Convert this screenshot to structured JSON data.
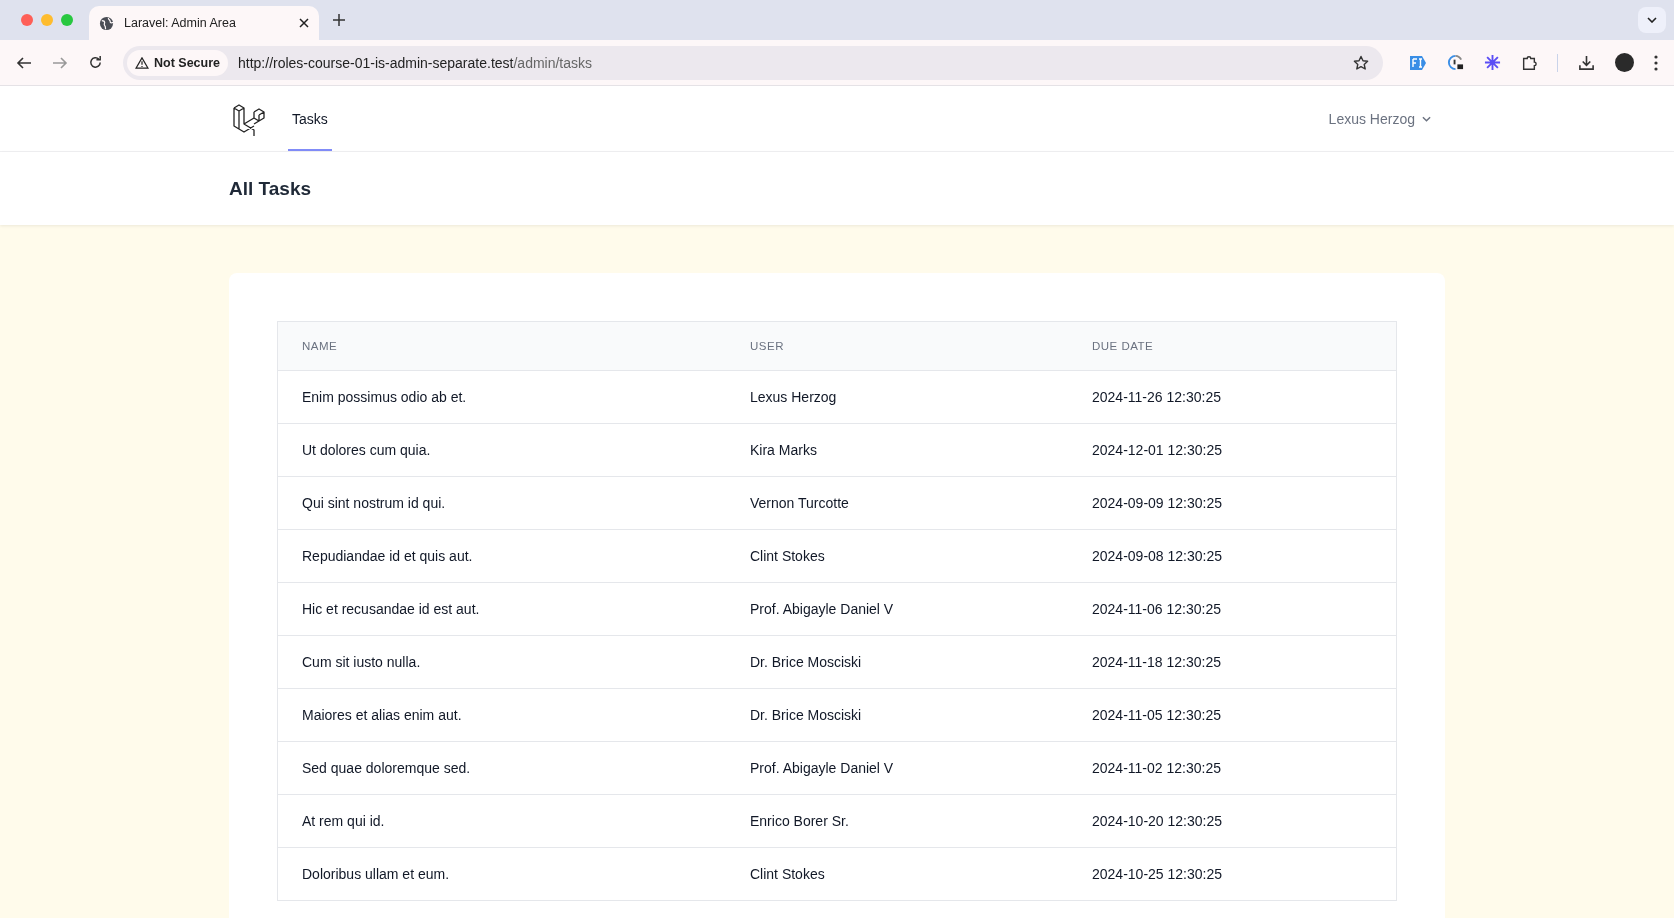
{
  "browser": {
    "tab": {
      "title": "Laravel: Admin Area"
    },
    "security_chip": "Not Secure",
    "url_host": "http://roles-course-01-is-admin-separate.test",
    "url_path": "/admin/tasks"
  },
  "nav": {
    "items": [
      {
        "label": "Tasks",
        "selected": true
      }
    ],
    "user": "Lexus Herzog"
  },
  "header": {
    "title": "All Tasks"
  },
  "table": {
    "columns": [
      "NAME",
      "USER",
      "DUE DATE"
    ],
    "rows": [
      [
        "Enim possimus odio ab et.",
        "Lexus Herzog",
        "2024-11-26 12:30:25"
      ],
      [
        "Ut dolores cum quia.",
        "Kira Marks",
        "2024-12-01 12:30:25"
      ],
      [
        "Qui sint nostrum id qui.",
        "Vernon Turcotte",
        "2024-09-09 12:30:25"
      ],
      [
        "Repudiandae id et quis aut.",
        "Clint Stokes",
        "2024-09-08 12:30:25"
      ],
      [
        "Hic et recusandae id est aut.",
        "Prof. Abigayle Daniel V",
        "2024-11-06 12:30:25"
      ],
      [
        "Cum sit iusto nulla.",
        "Dr. Brice Mosciski",
        "2024-11-18 12:30:25"
      ],
      [
        "Maiores et alias enim aut.",
        "Dr. Brice Mosciski",
        "2024-11-05 12:30:25"
      ],
      [
        "Sed quae doloremque sed.",
        "Prof. Abigayle Daniel V",
        "2024-11-02 12:30:25"
      ],
      [
        "At rem qui id.",
        "Enrico Borer Sr.",
        "2024-10-20 12:30:25"
      ],
      [
        "Doloribus ullam et eum.",
        "Clint Stokes",
        "2024-10-25 12:30:25"
      ]
    ]
  }
}
